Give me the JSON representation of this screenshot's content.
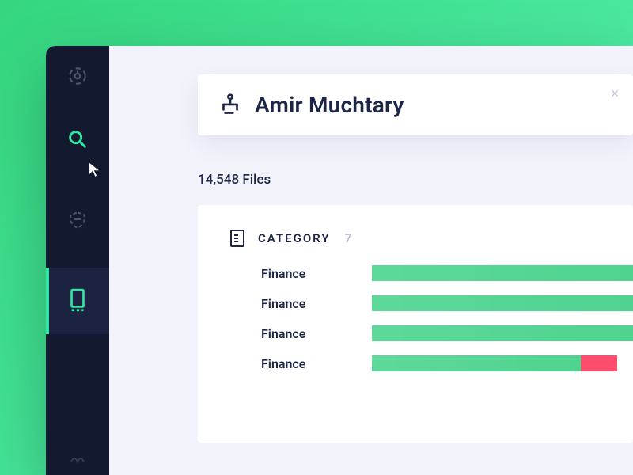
{
  "search": {
    "name": "Amir Muchtary"
  },
  "files": {
    "count_label": "14,548 Files"
  },
  "category": {
    "label": "CATEGORY",
    "count": "7",
    "rows": [
      {
        "label": "Finance",
        "green": 100,
        "red": 0
      },
      {
        "label": "Finance",
        "green": 100,
        "red": 0
      },
      {
        "label": "Finance",
        "green": 100,
        "red": 0
      },
      {
        "label": "Finance",
        "green": 80,
        "red": 14
      }
    ]
  }
}
